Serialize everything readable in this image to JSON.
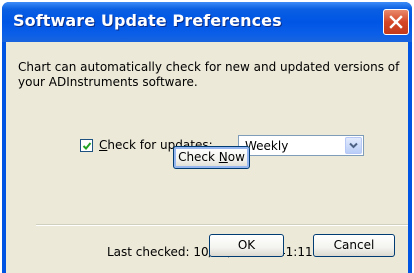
{
  "window": {
    "title": "Software Update Preferences"
  },
  "dialog": {
    "description": "Chart can automatically check for new and updated versions of your ADInstruments software.",
    "check_for_updates": {
      "label_prefix": "",
      "label_accel": "C",
      "label_rest": "heck for updates:",
      "checked": true
    },
    "frequency": {
      "selected": "Weekly"
    },
    "check_now_button": {
      "label_pre": "Check ",
      "label_accel": "N",
      "label_post": "ow"
    },
    "last_checked_text": "Last checked: 10/20/2006 5:41:11 PM",
    "ok_label": "OK",
    "cancel_label": "Cancel"
  },
  "icons": {
    "close": "close-icon",
    "checkmark": "checkmark-icon",
    "dropdown": "chevron-down-icon"
  },
  "colors": {
    "titlebar": "#0055e5",
    "close_button": "#d54727",
    "dialog_bg": "#ece9d8"
  }
}
